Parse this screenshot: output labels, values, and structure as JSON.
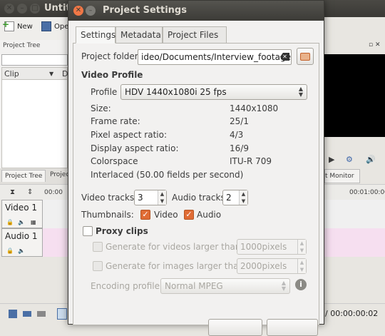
{
  "app": {
    "title": "Untitl",
    "toolbar": {
      "new_label": "New",
      "open_label": "Ope"
    },
    "project_tree": {
      "title": "Project Tree",
      "col_clip": "Clip",
      "col_d": "D"
    },
    "bottom_tabs": {
      "project_tree": "Project Tree",
      "project_other": "Projec"
    },
    "timeline": {
      "ruler_start": "00:00",
      "ruler_right": "00:01:00:00",
      "tracks": [
        {
          "label": "Video 1"
        },
        {
          "label": "Audio 1"
        }
      ]
    },
    "monitor": {
      "tab_label": "t Monitor",
      "timecode": "/ 00:00:00:02"
    }
  },
  "dialog": {
    "title": "Project Settings",
    "tabs": [
      {
        "label": "Settings",
        "active": true
      },
      {
        "label": "Metadata",
        "active": false
      },
      {
        "label": "Project Files",
        "active": false
      }
    ],
    "project_folder": {
      "label": "Project folder",
      "value": "ideo/Documents/Interview_footage"
    },
    "video_profile": {
      "heading": "Video Profile",
      "profile_label": "Profile",
      "profile_value": "HDV 1440x1080i 25 fps",
      "details": [
        {
          "label": "Size:",
          "value": "1440x1080"
        },
        {
          "label": "Frame rate:",
          "value": "25/1"
        },
        {
          "label": "Pixel aspect ratio:",
          "value": "4/3"
        },
        {
          "label": "Display aspect ratio:",
          "value": "16/9"
        },
        {
          "label": "Colorspace",
          "value": "ITU-R 709"
        }
      ],
      "interlaced": "Interlaced (50.00 fields per second)"
    },
    "tracks": {
      "video_label": "Video tracks",
      "video_value": "3",
      "audio_label": "Audio tracks",
      "audio_value": "2"
    },
    "thumbnails": {
      "label": "Thumbnails:",
      "video_label": "Video",
      "video_checked": true,
      "audio_label": "Audio",
      "audio_checked": true
    },
    "proxy": {
      "label": "Proxy clips",
      "checked": false,
      "videos_label": "Generate for videos larger than",
      "videos_value": "1000pixels",
      "images_label": "Generate for images larger than",
      "images_value": "2000pixels",
      "encoding_label": "Encoding profile",
      "encoding_value": "Normal MPEG"
    },
    "colors": {
      "accent": "#e06c35",
      "titlebar": "#3c3b37",
      "close": "#f07746"
    }
  }
}
